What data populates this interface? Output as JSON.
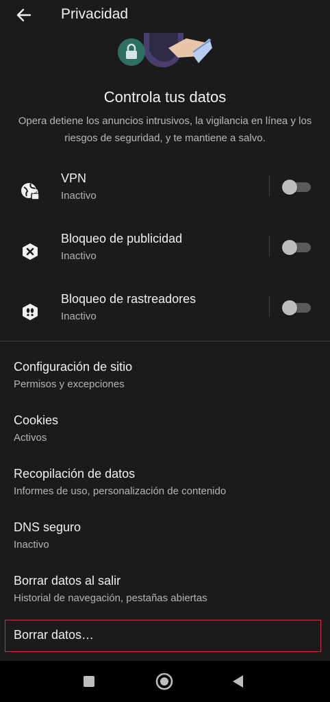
{
  "appbar": {
    "title": "Privacidad",
    "back_icon": "arrow-left-icon"
  },
  "hero": {
    "icon": "privacy-shield-illustration"
  },
  "header": {
    "title": "Controla tus datos",
    "subtitle": "Opera detiene los anuncios intrusivos, la vigilancia en línea y los riesgos de seguridad, y te mantiene a salvo."
  },
  "toggles": [
    {
      "title": "VPN",
      "status": "Inactivo",
      "icon": "globe-lock-icon",
      "enabled": false
    },
    {
      "title": "Bloqueo de publicidad",
      "status": "Inactivo",
      "icon": "ad-block-icon",
      "enabled": false
    },
    {
      "title": "Bloqueo de rastreadores",
      "status": "Inactivo",
      "icon": "tracker-block-icon",
      "enabled": false
    }
  ],
  "settings": [
    {
      "title": "Configuración de sitio",
      "subtitle": "Permisos y excepciones"
    },
    {
      "title": "Cookies",
      "subtitle": "Activos"
    },
    {
      "title": "Recopilación de datos",
      "subtitle": "Informes de uso, personalización de contenido"
    },
    {
      "title": "DNS seguro",
      "subtitle": "Inactivo"
    },
    {
      "title": "Borrar datos al salir",
      "subtitle": "Historial de navegación, pestañas abiertas"
    }
  ],
  "clear_data": {
    "label": "Borrar datos…",
    "border_color": "#c8304e"
  },
  "navbar": {
    "icons": [
      "recents-square-icon",
      "home-circle-icon",
      "back-triangle-icon"
    ]
  }
}
